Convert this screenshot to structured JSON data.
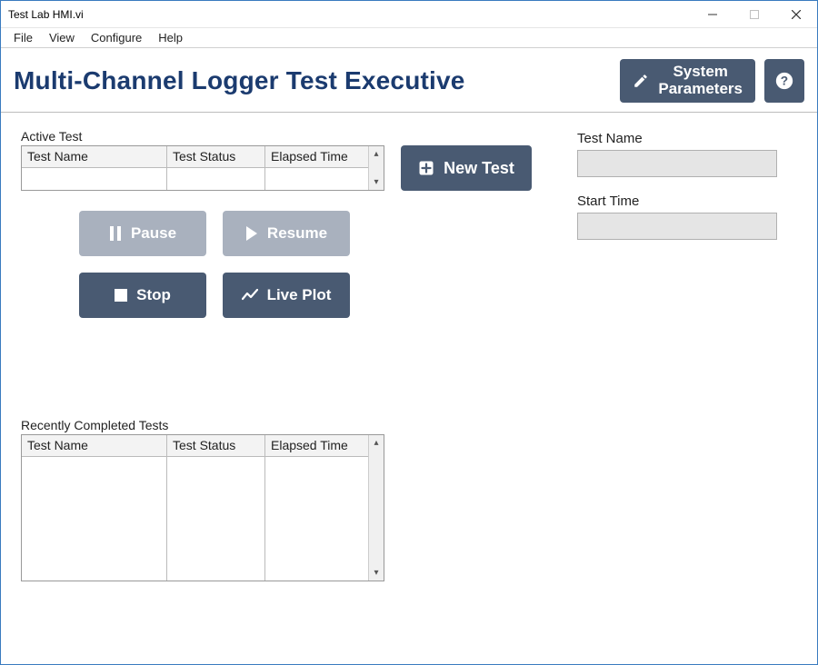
{
  "window": {
    "title": "Test Lab HMI.vi"
  },
  "menu": {
    "file": "File",
    "view": "View",
    "configure": "Configure",
    "help": "Help"
  },
  "header": {
    "title": "Multi-Channel Logger Test Executive",
    "system_parameters_line1": "System",
    "system_parameters_line2": "Parameters",
    "help_symbol": "?"
  },
  "active": {
    "section_label": "Active Test",
    "columns": {
      "name": "Test Name",
      "status": "Test Status",
      "elapsed": "Elapsed Time"
    },
    "rows": []
  },
  "buttons": {
    "new_test": "New Test",
    "pause": "Pause",
    "resume": "Resume",
    "stop": "Stop",
    "live_plot": "Live Plot"
  },
  "details": {
    "test_name_label": "Test Name",
    "test_name_value": "",
    "start_time_label": "Start Time",
    "start_time_value": ""
  },
  "completed": {
    "section_label": "Recently Completed Tests",
    "columns": {
      "name": "Test Name",
      "status": "Test Status",
      "elapsed": "Elapsed Time"
    },
    "rows": []
  },
  "colors": {
    "accent": "#495a72",
    "accent_disabled": "#a9b1be",
    "title_blue": "#1b3b6f"
  }
}
